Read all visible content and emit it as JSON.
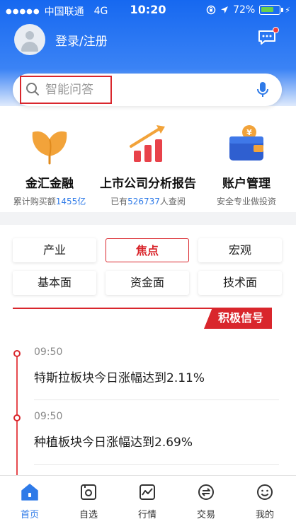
{
  "status_bar": {
    "carrier": "中国联通",
    "network": "4G",
    "time": "10:20",
    "battery": "72%",
    "battery_level": 0.72
  },
  "header": {
    "login_text": "登录/注册"
  },
  "search": {
    "placeholder": "智能问答"
  },
  "features": [
    {
      "title": "金汇金融",
      "sub_prefix": "累计购买额",
      "sub_highlight": "1455亿",
      "sub_suffix": ""
    },
    {
      "title": "上市公司分析报告",
      "sub_prefix": "已有",
      "sub_highlight": "526737",
      "sub_suffix": "人查阅"
    },
    {
      "title": "账户管理",
      "sub_prefix": "安全专业做投资",
      "sub_highlight": "",
      "sub_suffix": ""
    }
  ],
  "tags": [
    "产业",
    "焦点",
    "宏观",
    "基本面",
    "资金面",
    "技术面"
  ],
  "active_tag": "焦点",
  "signal_label": "积极信号",
  "news": [
    {
      "time": "09:50",
      "title": "特斯拉板块今日涨幅达到2.11%"
    },
    {
      "time": "09:50",
      "title": "种植板块今日涨幅达到2.69%"
    }
  ],
  "tabbar": [
    "首页",
    "自选",
    "行情",
    "交易",
    "我的"
  ],
  "colors": {
    "primary_blue": "#1668f0",
    "accent_red": "#d9262c",
    "highlight_blue": "#2e7ae8"
  }
}
